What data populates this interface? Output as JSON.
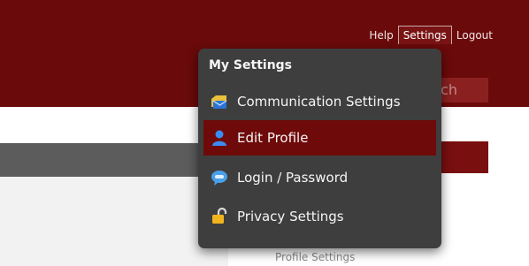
{
  "header": {
    "links": [
      {
        "label": "Help",
        "active": false
      },
      {
        "label": "Settings",
        "active": true
      },
      {
        "label": "Logout",
        "active": false
      }
    ],
    "search_partial": "arch"
  },
  "page": {
    "profile_settings_label": "Profile Settings"
  },
  "dropdown": {
    "title": "My Settings",
    "items": [
      {
        "label": "Communication Settings",
        "icon": "envelope-folder-icon",
        "selected": false
      },
      {
        "label": "Edit Profile",
        "icon": "user-icon",
        "selected": true
      },
      {
        "label": "Login / Password",
        "icon": "chat-login-icon",
        "selected": false
      },
      {
        "label": "Privacy Settings",
        "icon": "lock-icon",
        "selected": false
      }
    ]
  },
  "colors": {
    "brand": "#6b0a0a",
    "menu_bg": "#3e3e3e",
    "menu_selected": "#6f0a0a"
  }
}
